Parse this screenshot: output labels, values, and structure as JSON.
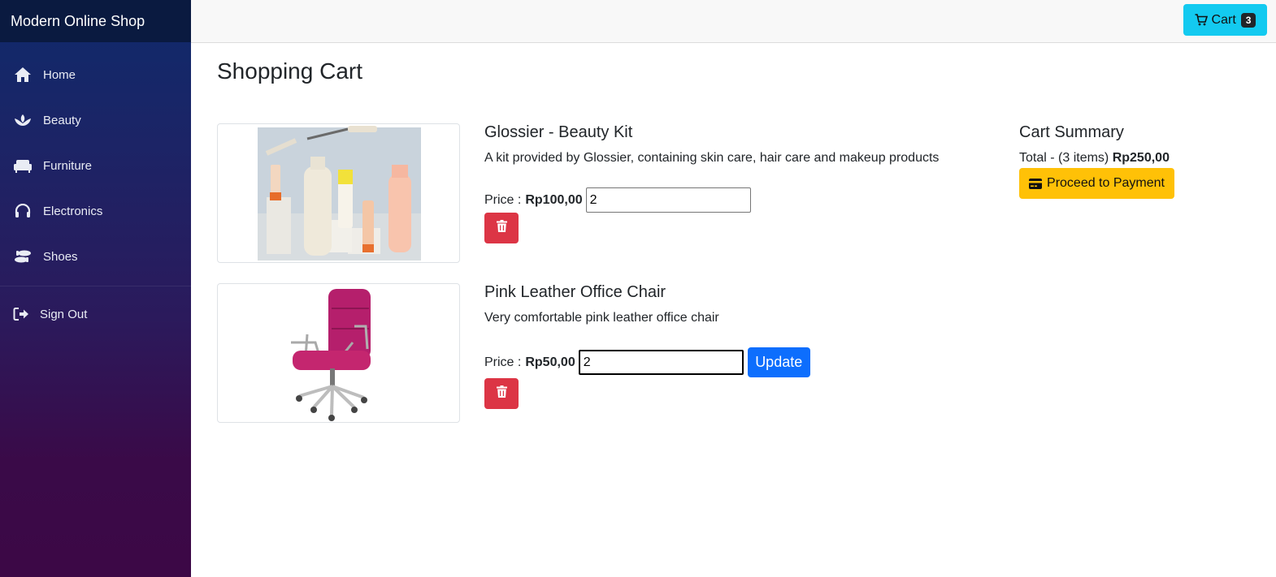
{
  "brand": "Modern Online Shop",
  "sidebar": {
    "items": [
      {
        "label": "Home",
        "icon": "home-icon"
      },
      {
        "label": "Beauty",
        "icon": "lotus-icon"
      },
      {
        "label": "Furniture",
        "icon": "couch-icon"
      },
      {
        "label": "Electronics",
        "icon": "headphones-icon"
      },
      {
        "label": "Shoes",
        "icon": "shoe-prints-icon"
      }
    ],
    "signout": {
      "label": "Sign Out",
      "icon": "sign-out-icon"
    }
  },
  "topbar": {
    "cart_label": "Cart",
    "cart_count": "3",
    "cart_color": "#13caf0"
  },
  "main": {
    "title": "Shopping Cart",
    "price_prefix": "Price :",
    "items": [
      {
        "name": "Glossier - Beauty Kit",
        "description": "A kit provided by Glossier, containing skin care, hair care and makeup products",
        "price": "Rp100,00",
        "quantity": "2"
      },
      {
        "name": "Pink Leather Office Chair",
        "description": "Very comfortable pink leather office chair",
        "price": "Rp50,00",
        "quantity": "2",
        "update_label": "Update"
      }
    ]
  },
  "summary": {
    "title": "Cart Summary",
    "total_prefix": "Total - (3 items)",
    "total_value": "Rp250,00",
    "pay_label": "Proceed to Payment"
  },
  "colors": {
    "danger": "#dc3545",
    "primary": "#0d6efd",
    "warning": "#ffc107"
  }
}
